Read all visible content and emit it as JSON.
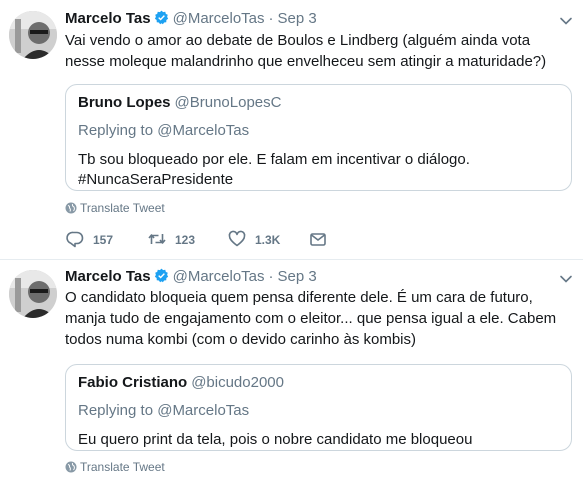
{
  "colors": {
    "text": "#14171a",
    "secondary": "#657786",
    "verified": "#1da1f2",
    "border": "#ccd6dd"
  },
  "tweets": [
    {
      "author_name": "Marcelo Tas",
      "author_handle": "@MarceloTas",
      "separator": "·",
      "date": "Sep 3",
      "text": "Vai vendo o amor ao debate de Boulos e Lindberg (alguém ainda vota nesse moleque malandrinho que envelheceu sem atingir a maturidade?)",
      "quote": {
        "author_name": "Bruno Lopes",
        "author_handle": "@BrunoLopesC",
        "replying_to": "Replying to @MarceloTas",
        "text_line1": "Tb sou bloqueado por ele. E falam em incentivar o diálogo.",
        "text_line2": "#NuncaSeraPresidente"
      },
      "translate_label": "Translate Tweet",
      "replies": "157",
      "retweets": "123",
      "likes": "1.3K"
    },
    {
      "author_name": "Marcelo Tas",
      "author_handle": "@MarceloTas",
      "separator": "·",
      "date": "Sep 3",
      "text": "O candidato bloqueia quem pensa diferente dele. É um cara de futuro, manja tudo de engajamento com o eleitor... que pensa igual a ele. Cabem todos numa kombi (com o devido carinho às kombis)",
      "quote": {
        "author_name": "Fabio Cristiano",
        "author_handle": "@bicudo2000",
        "replying_to": "Replying to @MarceloTas",
        "text_line1": "Eu quero print da tela, pois o nobre candidato me bloqueou"
      },
      "translate_label": "Translate Tweet"
    }
  ]
}
